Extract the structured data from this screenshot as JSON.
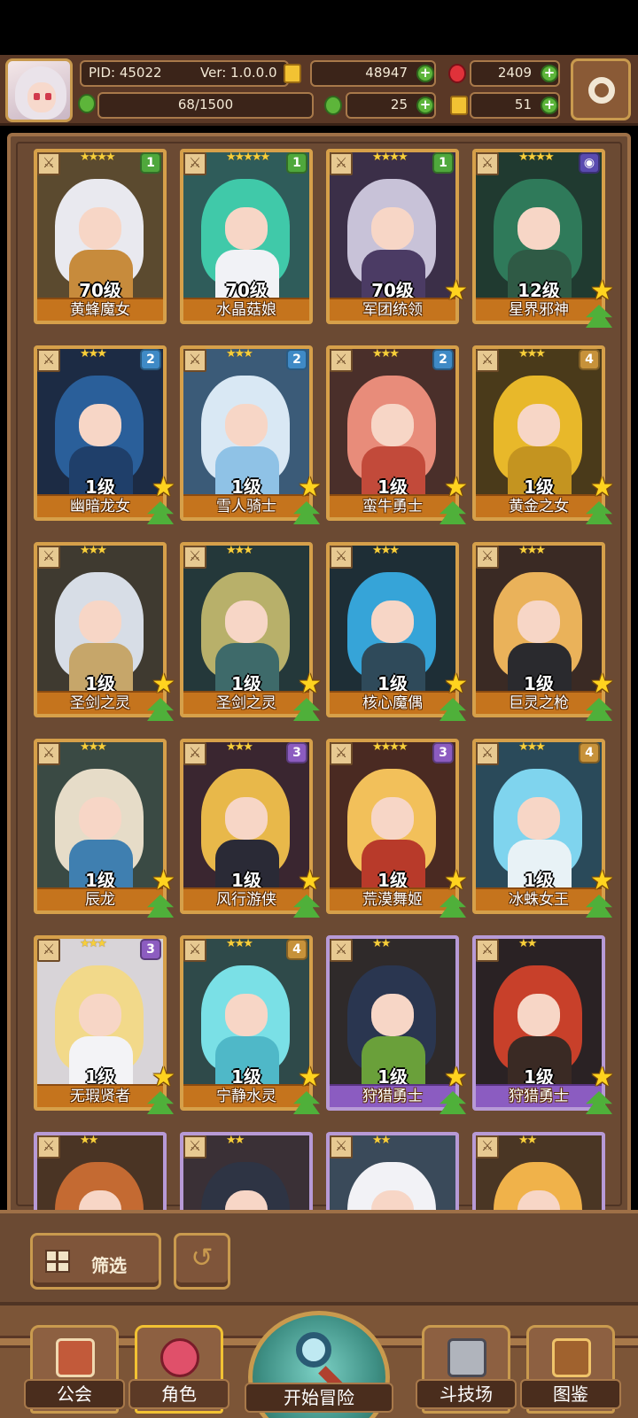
{
  "header": {
    "pid": "PID: 45022",
    "version": "Ver: 1.0.0.0",
    "gold": "48947",
    "gems": "2409",
    "stamina": "68/1500",
    "clover": "25",
    "keys": "51"
  },
  "cards": [
    {
      "stars": "★★★★",
      "badge": "1",
      "badge_color": "#4fa83c",
      "level": "70级",
      "name": "黄蜂魔女",
      "hair": "#e9e9ef",
      "outfit": "#c78b3c",
      "bg": "#5b4a2f",
      "rarity": "gold",
      "star_up": false,
      "arrow_up": false
    },
    {
      "stars": "★★★★★",
      "badge": "1",
      "badge_color": "#4fa83c",
      "level": "70级",
      "name": "水晶菇娘",
      "hair": "#40c9a9",
      "outfit": "#f1f2f6",
      "bg": "#2f5c5a",
      "rarity": "gold",
      "star_up": false,
      "arrow_up": false
    },
    {
      "stars": "★★★★",
      "badge": "1",
      "badge_color": "#4fa83c",
      "level": "70级",
      "name": "军团统领",
      "hair": "#c8c2d8",
      "outfit": "#4b3b64",
      "bg": "#3b2f48",
      "rarity": "gold",
      "star_up": true,
      "arrow_up": false
    },
    {
      "stars": "★★★★",
      "badge": "◉",
      "badge_color": "#5a4bb0",
      "level": "12级",
      "name": "星界邪神",
      "hair": "#2f7a5a",
      "outfit": "#2f5a45",
      "bg": "#203a30",
      "rarity": "gold",
      "star_up": true,
      "arrow_up": true
    },
    {
      "stars": "★★★",
      "badge": "2",
      "badge_color": "#3f8ac6",
      "level": "1级",
      "name": "幽暗龙女",
      "hair": "#2a5f9a",
      "outfit": "#1f3f6a",
      "bg": "#1c2b44",
      "rarity": "gold",
      "star_up": true,
      "arrow_up": true
    },
    {
      "stars": "★★★",
      "badge": "2",
      "badge_color": "#3f8ac6",
      "level": "1级",
      "name": "雪人骑士",
      "hair": "#d9e8f4",
      "outfit": "#8fc2e6",
      "bg": "#3b5b78",
      "rarity": "gold",
      "star_up": true,
      "arrow_up": true
    },
    {
      "stars": "★★★",
      "badge": "2",
      "badge_color": "#3f8ac6",
      "level": "1级",
      "name": "蛮牛勇士",
      "hair": "#e88c7a",
      "outfit": "#c24a3a",
      "bg": "#4a2f2a",
      "rarity": "gold",
      "star_up": true,
      "arrow_up": true
    },
    {
      "stars": "★★★",
      "badge": "4",
      "badge_color": "#c7923a",
      "level": "1级",
      "name": "黄金之女",
      "hair": "#e8b82a",
      "outfit": "#c49420",
      "bg": "#4a3a1a",
      "rarity": "gold",
      "star_up": true,
      "arrow_up": true
    },
    {
      "stars": "★★★",
      "badge": "",
      "badge_color": "",
      "level": "1级",
      "name": "圣剑之灵",
      "hair": "#d7dde6",
      "outfit": "#c6a66a",
      "bg": "#3f3a30",
      "rarity": "gold",
      "star_up": true,
      "arrow_up": true
    },
    {
      "stars": "★★★",
      "badge": "",
      "badge_color": "",
      "level": "1级",
      "name": "圣剑之灵",
      "hair": "#b8b06a",
      "outfit": "#3e6a6a",
      "bg": "#24383a",
      "rarity": "gold",
      "star_up": true,
      "arrow_up": true
    },
    {
      "stars": "★★★",
      "badge": "",
      "badge_color": "",
      "level": "1级",
      "name": "核心魔偶",
      "hair": "#36a4d8",
      "outfit": "#2f4a5a",
      "bg": "#1e2e36",
      "rarity": "gold",
      "star_up": true,
      "arrow_up": true
    },
    {
      "stars": "★★★",
      "badge": "",
      "badge_color": "",
      "level": "1级",
      "name": "巨灵之枪",
      "hair": "#eab25a",
      "outfit": "#2a2a2e",
      "bg": "#3a2a24",
      "rarity": "gold",
      "star_up": true,
      "arrow_up": true
    },
    {
      "stars": "★★★",
      "badge": "",
      "badge_color": "",
      "level": "1级",
      "name": "辰龙",
      "hair": "#e6dcc8",
      "outfit": "#3f7fb0",
      "bg": "#3a4a44",
      "rarity": "gold",
      "star_up": true,
      "arrow_up": true
    },
    {
      "stars": "★★★",
      "badge": "3",
      "badge_color": "#8c5cc0",
      "level": "1级",
      "name": "风行游侠",
      "hair": "#e8b84a",
      "outfit": "#2a2a36",
      "bg": "#3a2630",
      "rarity": "gold",
      "star_up": true,
      "arrow_up": true
    },
    {
      "stars": "★★★★",
      "badge": "3",
      "badge_color": "#8c5cc0",
      "level": "1级",
      "name": "荒漠舞姬",
      "hair": "#f2c05a",
      "outfit": "#b83a2a",
      "bg": "#4a2a22",
      "rarity": "gold",
      "star_up": true,
      "arrow_up": true
    },
    {
      "stars": "★★★",
      "badge": "4",
      "badge_color": "#c7923a",
      "level": "1级",
      "name": "冰蛛女王",
      "hair": "#7fd4ee",
      "outfit": "#e8f2f6",
      "bg": "#2a4a5a",
      "rarity": "gold",
      "star_up": true,
      "arrow_up": true
    },
    {
      "stars": "★★★",
      "badge": "3",
      "badge_color": "#8c5cc0",
      "level": "1级",
      "name": "无瑕贤者",
      "hair": "#f2d98a",
      "outfit": "#f3f3f6",
      "bg": "#d8d4d8",
      "rarity": "gold",
      "star_up": true,
      "arrow_up": true
    },
    {
      "stars": "★★★",
      "badge": "4",
      "badge_color": "#c7923a",
      "level": "1级",
      "name": "宁静水灵",
      "hair": "#7ae0e6",
      "outfit": "#4fb8c8",
      "bg": "#2f4a4a",
      "rarity": "gold",
      "star_up": true,
      "arrow_up": true
    },
    {
      "stars": "★★",
      "badge": "",
      "badge_color": "",
      "level": "1级",
      "name": "狩猎勇士",
      "hair": "#2a3650",
      "outfit": "#6aa03a",
      "bg": "#2f2a2a",
      "rarity": "purple",
      "star_up": true,
      "arrow_up": true
    },
    {
      "stars": "★★",
      "badge": "",
      "badge_color": "",
      "level": "1级",
      "name": "狩猎勇士",
      "hair": "#c8402a",
      "outfit": "#3a2a24",
      "bg": "#2a2224",
      "rarity": "purple",
      "star_up": true,
      "arrow_up": true
    }
  ],
  "partial_cards": [
    {
      "stars": "★★",
      "hair": "#c46a32",
      "bg": "#4a3424"
    },
    {
      "stars": "★★",
      "hair": "#2e3444",
      "bg": "#3a3036"
    },
    {
      "stars": "★★",
      "hair": "#f2f2f6",
      "bg": "#3a4a5a"
    },
    {
      "stars": "★★",
      "hair": "#f0b24a",
      "bg": "#4a3624"
    }
  ],
  "filter": {
    "label": "筛选"
  },
  "nav": {
    "guild": "公会",
    "roles": "角色",
    "adventure": "开始冒险",
    "arena": "斗技场",
    "codex": "图鉴"
  }
}
